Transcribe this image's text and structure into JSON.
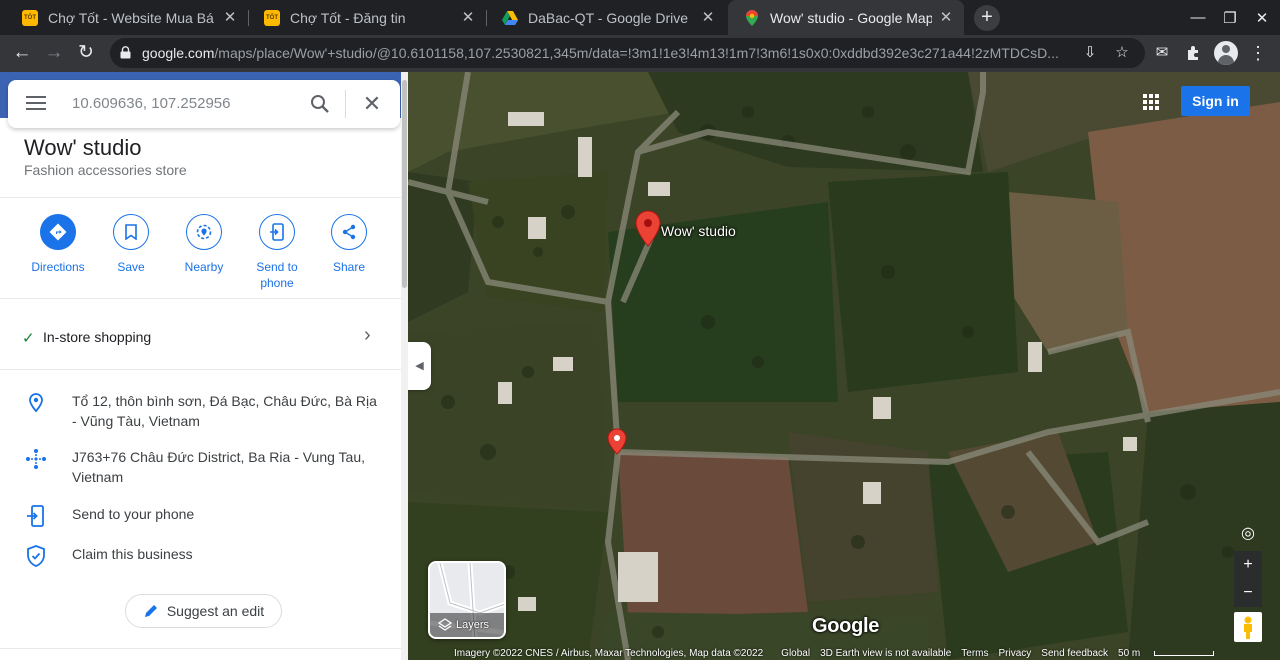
{
  "browser": {
    "tabs": [
      {
        "title": "Chợ Tốt - Website Mua Bá",
        "favicon": "cho-tot-icon",
        "badge": "TỐT"
      },
      {
        "title": "Chợ Tốt - Đăng tin",
        "favicon": "cho-tot-icon",
        "badge": "TỐT"
      },
      {
        "title": "DaBac-QT - Google Drive",
        "favicon": "google-drive-icon"
      },
      {
        "title": "Wow' studio - Google Map",
        "favicon": "google-maps-icon",
        "active": true
      }
    ],
    "url_host": "google.com",
    "url_path": "/maps/place/Wow'+studio/@10.6101158,107.2530821,345m/data=!3m1!1e3!4m13!1m7!3m6!1s0x0:0xddbd392e3c271a44!2zMTDCsD..."
  },
  "search": {
    "query": "10.609636, 107.252956"
  },
  "place": {
    "name": "Wow' studio",
    "category": "Fashion accessories store",
    "actions": [
      {
        "label": "Directions",
        "icon": "directions-icon"
      },
      {
        "label": "Save",
        "icon": "bookmark-icon"
      },
      {
        "label": "Nearby",
        "icon": "nearby-icon"
      },
      {
        "label_line1": "Send to",
        "label_line2": "phone",
        "icon": "send-to-phone-icon"
      },
      {
        "label": "Share",
        "icon": "share-icon"
      }
    ],
    "attribute": "In-store shopping",
    "address": "Tổ 12, thôn bình sơn, Đá Bạc, Châu Đức, Bà Rịa - Vũng Tàu, Vietnam",
    "plus_code": "J763+76 Châu Đức District, Ba Ria - Vung Tau, Vietnam",
    "send_to_phone": "Send to your phone",
    "claim": "Claim this business",
    "suggest_edit": "Suggest an edit"
  },
  "map": {
    "pin_label": "Wow' studio",
    "sign_in": "Sign in",
    "layers_label": "Layers",
    "logo": "Google",
    "attribution": "Imagery ©2022 CNES / Airbus, Maxar Technologies, Map data ©2022",
    "footer_links": [
      "Global",
      "3D Earth view is not available",
      "Terms",
      "Privacy",
      "Send feedback"
    ],
    "scale_label": "50 m",
    "zoom_in": "+",
    "zoom_out": "−"
  },
  "colors": {
    "accent": "#1a73e8",
    "pin": "#ea4335",
    "check": "#188038"
  }
}
